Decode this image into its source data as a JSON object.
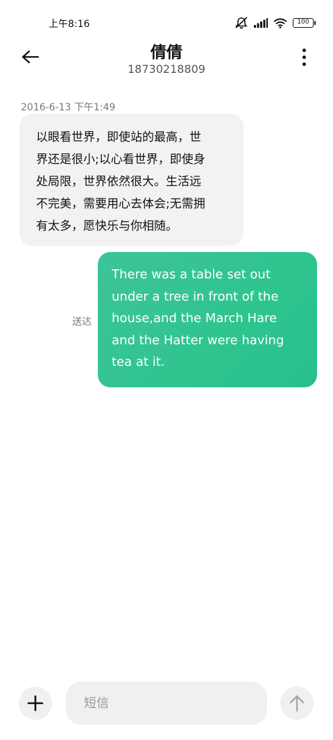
{
  "status_bar": {
    "time": "上午8:16",
    "battery": "100",
    "icons": [
      "mute-bell-icon",
      "signal-icon",
      "wifi-icon",
      "battery-icon"
    ]
  },
  "header": {
    "contact_name": "倩倩",
    "contact_number": "18730218809",
    "back_icon": "back-arrow-icon",
    "more_icon": "more-vertical-icon"
  },
  "conversation": {
    "timestamp": "2016-6-13 下午1:49",
    "incoming": {
      "lines": [
        "以眼看世界，即使站的最高，世",
        "界还是很小;以心看世界，即使身",
        "处局限，世界依然很大。生活远",
        "不完美，需要用心去体会;无需拥",
        "有太多，愿快乐与你相随。"
      ]
    },
    "outgoing": {
      "status": "送达",
      "lines": [
        "There was a table set out",
        "under a tree in front of the",
        "house,and the March Hare",
        "and the Hatter were having",
        "tea at it."
      ]
    }
  },
  "composer": {
    "placeholder": "短信",
    "value": "",
    "add_icon": "plus-icon",
    "send_icon": "send-arrow-up-icon"
  },
  "colors": {
    "outgoing_bubble": "#2fc48e",
    "incoming_bubble": "#f2f2f2",
    "background": "#ffffff"
  }
}
